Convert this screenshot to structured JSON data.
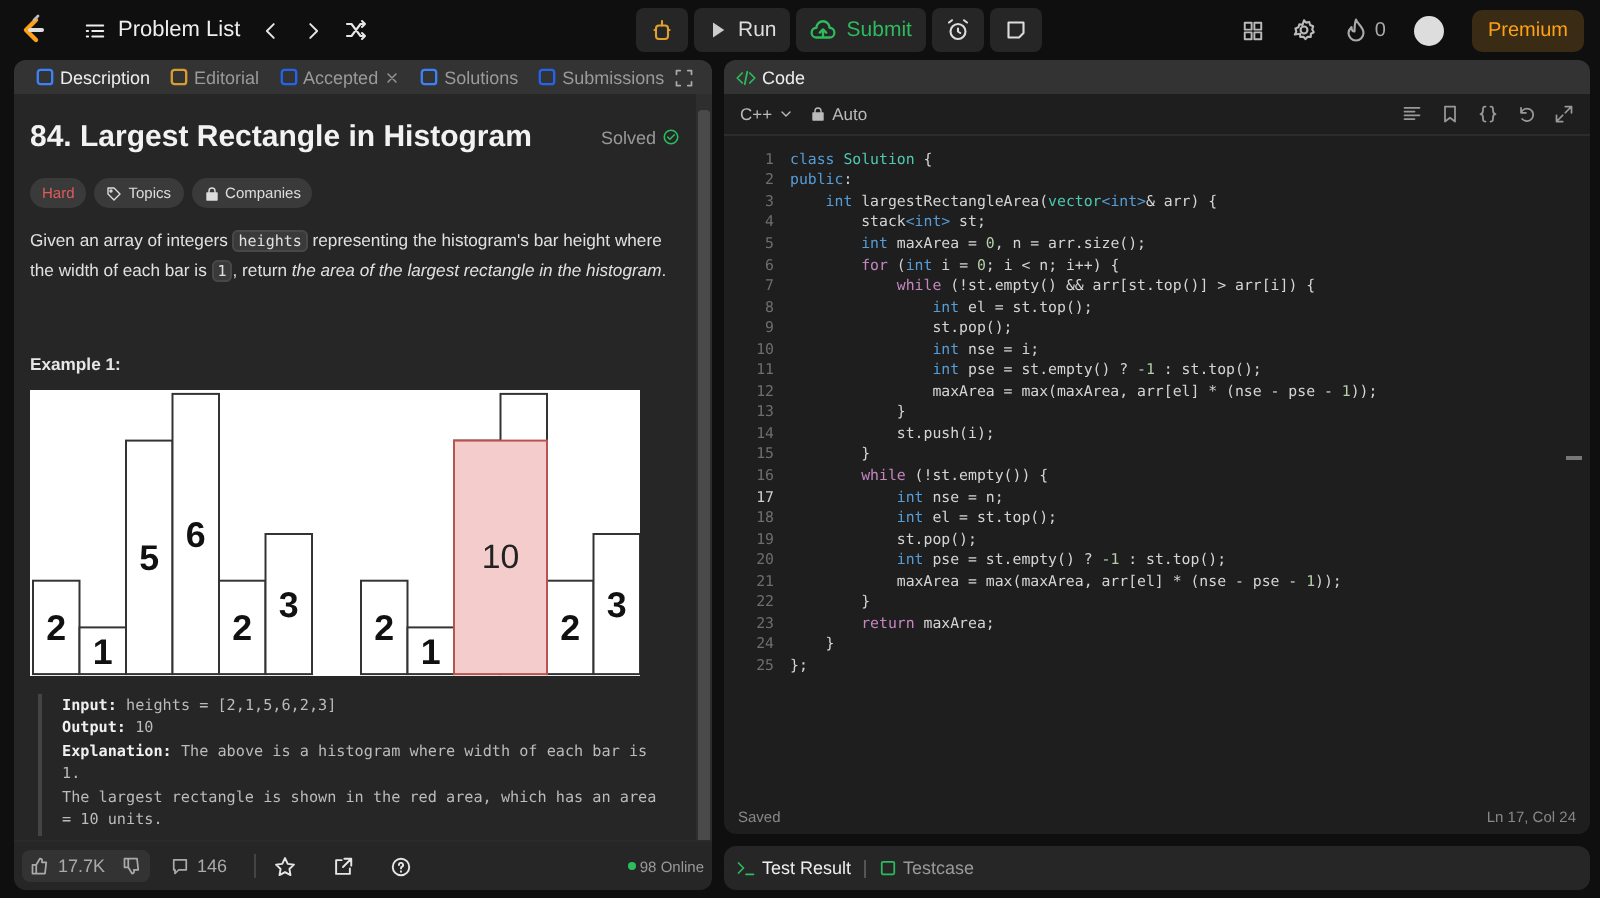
{
  "top_bar": {
    "problem_list": "Problem List",
    "run": "Run",
    "submit": "Submit",
    "streak": "0",
    "premium": "Premium"
  },
  "left_panel": {
    "tabs": [
      {
        "label": "Description",
        "selected": true,
        "kind": "description",
        "closable": false
      },
      {
        "label": "Editorial",
        "selected": false,
        "kind": "editorial",
        "closable": false
      },
      {
        "label": "Accepted",
        "selected": false,
        "kind": "accepted",
        "closable": true
      },
      {
        "label": "Solutions",
        "selected": false,
        "kind": "solutions",
        "closable": false
      },
      {
        "label": "Submissions",
        "selected": false,
        "kind": "submissions",
        "closable": false
      }
    ],
    "title": "84. Largest Rectangle in Histogram",
    "status": "Solved",
    "tags": [
      {
        "label": "Hard",
        "kind": "difficulty"
      },
      {
        "label": "Topics",
        "kind": "topics"
      },
      {
        "label": "Companies",
        "kind": "companies"
      }
    ],
    "description": [
      {
        "kind": "text",
        "text": "Given an array of integers "
      },
      {
        "kind": "code",
        "text": "heights"
      },
      {
        "kind": "text",
        "text": " representing the histogram's bar height where the width of each bar is "
      },
      {
        "kind": "code",
        "text": "1"
      },
      {
        "kind": "text",
        "text": ", return *the area of the largest rectangle in the histogram*."
      }
    ],
    "example_heading": "Example 1:",
    "figure": {
      "histograms": [
        {
          "bars": [
            {
              "label": "2",
              "highlighted": false
            },
            {
              "label": "1",
              "highlighted": false
            },
            {
              "label": "5",
              "highlighted": false
            },
            {
              "label": "6",
              "highlighted": false
            },
            {
              "label": "2",
              "highlighted": false
            },
            {
              "label": "3",
              "highlighted": false
            }
          ]
        },
        {
          "bars": [
            {
              "label": "2",
              "highlighted": false
            },
            {
              "label": "1",
              "highlighted": false
            },
            {
              "highlighted": true
            },
            {
              "highlighted": true
            },
            {
              "label": "2",
              "highlighted": false
            },
            {
              "label": "3",
              "highlighted": false
            }
          ],
          "highlight_label": "10"
        }
      ]
    },
    "example": [
      {
        "text": "**Input:** heights = [2,1,5,6,2,3]"
      },
      {
        "text": "**Output:** 10"
      },
      {
        "text": "**Explanation:** The above is a histogram where width of each bar is 1."
      },
      {
        "text": "The largest rectangle is shown in the red area, which has an area = 10 units."
      }
    ],
    "footer": {
      "likes": "17.7K",
      "comments": "146",
      "online": "98 Online"
    }
  },
  "code_panel": {
    "title": "Code",
    "language": "C++",
    "mode": "Auto",
    "status": "Saved",
    "cursor": "Ln 17, Col 24",
    "lines": [
      {
        "number": "1",
        "current": false,
        "tokens": [
          {
            "kind": "keyword",
            "text": "class"
          },
          {
            "kind": "type",
            "text": " Solution"
          },
          {
            "kind": "plain",
            "text": " {"
          }
        ]
      },
      {
        "number": "2",
        "current": false,
        "tokens": [
          {
            "kind": "keyword",
            "text": "public"
          },
          {
            "kind": "plain",
            "text": ":"
          }
        ]
      },
      {
        "number": "3",
        "current": false,
        "tokens": [
          {
            "kind": "keyword",
            "text": "    int"
          },
          {
            "kind": "plain",
            "text": " largestRectangleArea("
          },
          {
            "kind": "type",
            "text": "vector"
          },
          {
            "kind": "keyword",
            "text": "<int>"
          },
          {
            "kind": "plain",
            "text": "& arr) {"
          }
        ]
      },
      {
        "number": "4",
        "current": false,
        "tokens": [
          {
            "kind": "plain",
            "text": "        stack"
          },
          {
            "kind": "keyword",
            "text": "<int>"
          },
          {
            "kind": "plain",
            "text": " st;"
          }
        ]
      },
      {
        "number": "5",
        "current": false,
        "tokens": [
          {
            "kind": "keyword",
            "text": "        int"
          },
          {
            "kind": "plain",
            "text": " maxArea = "
          },
          {
            "kind": "number",
            "text": "0"
          },
          {
            "kind": "plain",
            "text": ", n = arr.size();"
          }
        ]
      },
      {
        "number": "6",
        "current": false,
        "tokens": [
          {
            "kind": "control",
            "text": "        for"
          },
          {
            "kind": "plain",
            "text": " ("
          },
          {
            "kind": "keyword",
            "text": "int"
          },
          {
            "kind": "plain",
            "text": " i = "
          },
          {
            "kind": "number",
            "text": "0"
          },
          {
            "kind": "plain",
            "text": "; i < n; i++) {"
          }
        ]
      },
      {
        "number": "7",
        "current": false,
        "tokens": [
          {
            "kind": "control",
            "text": "            while"
          },
          {
            "kind": "plain",
            "text": " (!st.empty() && arr[st.top()] > arr[i]) {"
          }
        ]
      },
      {
        "number": "8",
        "current": false,
        "tokens": [
          {
            "kind": "keyword",
            "text": "                int"
          },
          {
            "kind": "plain",
            "text": " el = st.top();"
          }
        ]
      },
      {
        "number": "9",
        "current": false,
        "tokens": [
          {
            "kind": "plain",
            "text": "                st.pop();"
          }
        ]
      },
      {
        "number": "10",
        "current": false,
        "tokens": [
          {
            "kind": "keyword",
            "text": "                int"
          },
          {
            "kind": "plain",
            "text": " nse = i;"
          }
        ]
      },
      {
        "number": "11",
        "current": false,
        "tokens": [
          {
            "kind": "keyword",
            "text": "                int"
          },
          {
            "kind": "plain",
            "text": " pse = st.empty() ? "
          },
          {
            "kind": "number",
            "text": "-1"
          },
          {
            "kind": "plain",
            "text": " : st.top();"
          }
        ]
      },
      {
        "number": "12",
        "current": false,
        "tokens": [
          {
            "kind": "plain",
            "text": "                maxArea = max(maxArea, arr[el] * (nse - pse - "
          },
          {
            "kind": "number",
            "text": "1"
          },
          {
            "kind": "plain",
            "text": "));"
          }
        ]
      },
      {
        "number": "13",
        "current": false,
        "tokens": [
          {
            "kind": "plain",
            "text": "            }"
          }
        ]
      },
      {
        "number": "14",
        "current": false,
        "tokens": [
          {
            "kind": "plain",
            "text": "            st.push(i);"
          }
        ]
      },
      {
        "number": "15",
        "current": false,
        "tokens": [
          {
            "kind": "plain",
            "text": "        }"
          }
        ]
      },
      {
        "number": "16",
        "current": false,
        "tokens": [
          {
            "kind": "control",
            "text": "        while"
          },
          {
            "kind": "plain",
            "text": " (!st.empty()) {"
          }
        ]
      },
      {
        "number": "17",
        "current": true,
        "tokens": [
          {
            "kind": "keyword",
            "text": "            int"
          },
          {
            "kind": "plain",
            "text": " nse = n;"
          }
        ]
      },
      {
        "number": "18",
        "current": false,
        "tokens": [
          {
            "kind": "keyword",
            "text": "            int"
          },
          {
            "kind": "plain",
            "text": " el = st.top();"
          }
        ]
      },
      {
        "number": "19",
        "current": false,
        "tokens": [
          {
            "kind": "plain",
            "text": "            st.pop();"
          }
        ]
      },
      {
        "number": "20",
        "current": false,
        "tokens": [
          {
            "kind": "keyword",
            "text": "            int"
          },
          {
            "kind": "plain",
            "text": " pse = st.empty() ? "
          },
          {
            "kind": "number",
            "text": "-1"
          },
          {
            "kind": "plain",
            "text": " : st.top();"
          }
        ]
      },
      {
        "number": "21",
        "current": false,
        "tokens": [
          {
            "kind": "plain",
            "text": "            maxArea = max(maxArea, arr[el] * (nse - pse - "
          },
          {
            "kind": "number",
            "text": "1"
          },
          {
            "kind": "plain",
            "text": "));"
          }
        ]
      },
      {
        "number": "22",
        "current": false,
        "tokens": [
          {
            "kind": "plain",
            "text": "        }"
          }
        ]
      },
      {
        "number": "23",
        "current": false,
        "tokens": [
          {
            "kind": "control",
            "text": "        return"
          },
          {
            "kind": "plain",
            "text": " maxArea;"
          }
        ]
      },
      {
        "number": "24",
        "current": false,
        "tokens": [
          {
            "kind": "plain",
            "text": "    }"
          }
        ]
      },
      {
        "number": "25",
        "current": false,
        "tokens": [
          {
            "kind": "plain",
            "text": "};"
          }
        ]
      }
    ]
  },
  "bottom_panel": {
    "tabs": [
      {
        "label": "Test Result",
        "selected": true,
        "kind": "result"
      },
      {
        "label": "Testcase",
        "selected": false,
        "kind": "testcase"
      }
    ]
  }
}
